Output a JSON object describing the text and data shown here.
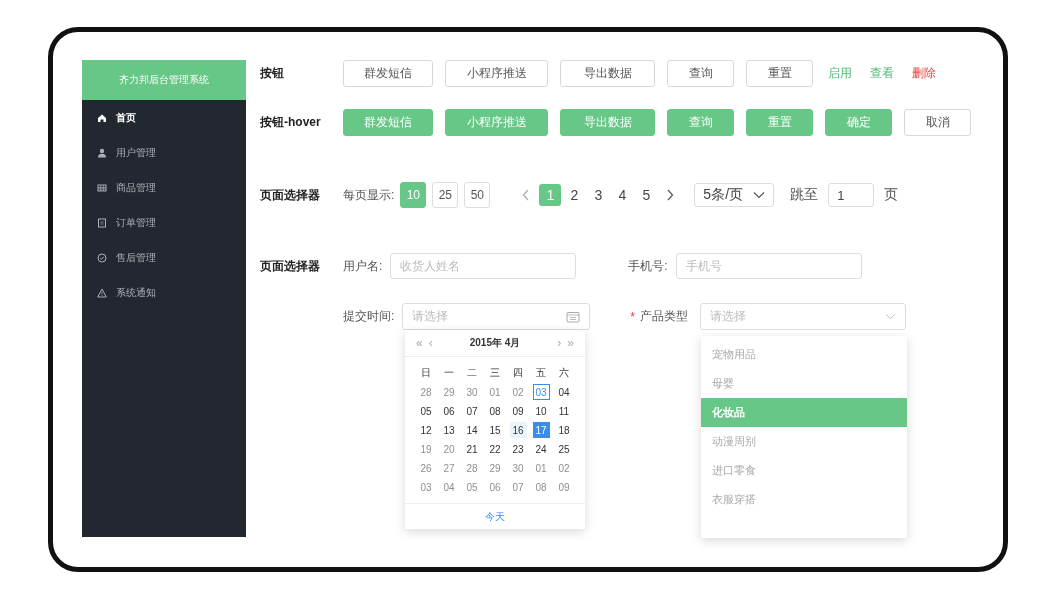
{
  "sidebar": {
    "title": "齐力邦后台管理系统",
    "items": [
      {
        "label": "首页",
        "selected": true
      },
      {
        "label": "用户管理",
        "selected": false
      },
      {
        "label": "商品管理",
        "selected": false
      },
      {
        "label": "订单管理",
        "selected": false
      },
      {
        "label": "售后管理",
        "selected": false
      },
      {
        "label": "系统通知",
        "selected": false
      }
    ]
  },
  "button_rows": [
    {
      "label": "按钮",
      "buttons": [
        {
          "label": "群发短信",
          "kind": "outline"
        },
        {
          "label": "小程序推送",
          "kind": "outline"
        },
        {
          "label": "导出数据",
          "kind": "outline"
        },
        {
          "label": "查询",
          "kind": "outline"
        },
        {
          "label": "重置",
          "kind": "outline"
        },
        {
          "label": "启用",
          "kind": "link-success"
        },
        {
          "label": "查看",
          "kind": "link-success"
        },
        {
          "label": "删除",
          "kind": "link-danger"
        }
      ]
    },
    {
      "label": "按钮-hover",
      "buttons": [
        {
          "label": "群发短信",
          "kind": "filled"
        },
        {
          "label": "小程序推送",
          "kind": "filled"
        },
        {
          "label": "导出数据",
          "kind": "filled"
        },
        {
          "label": "查询",
          "kind": "filled"
        },
        {
          "label": "重置",
          "kind": "filled"
        },
        {
          "label": "确定",
          "kind": "filled"
        },
        {
          "label": "取消",
          "kind": "outline"
        }
      ]
    }
  ],
  "pagination": {
    "label": "页面选择器",
    "page_size_label": "每页显示:",
    "page_sizes": [
      {
        "label": "10",
        "selected": true
      },
      {
        "label": "25",
        "selected": false
      },
      {
        "label": "50",
        "selected": false
      }
    ],
    "pages": [
      {
        "label": "1",
        "selected": true
      },
      {
        "label": "2",
        "selected": false
      },
      {
        "label": "3",
        "selected": false
      },
      {
        "label": "4",
        "selected": false
      },
      {
        "label": "5",
        "selected": false
      }
    ],
    "per_page": "5条/页",
    "jump_label": "跳至",
    "jump_value": "1",
    "page_unit": "页"
  },
  "form": {
    "label": "页面选择器",
    "username": {
      "label": "用户名:",
      "placeholder": "收货人姓名"
    },
    "phone": {
      "label": "手机号:",
      "placeholder": "手机号"
    },
    "submit_time": {
      "label": "提交时间:",
      "placeholder": "请选择"
    },
    "product_type": {
      "label": "产品类型",
      "required_mark": "*",
      "placeholder": "请选择",
      "options": [
        {
          "label": "宠物用品",
          "selected": false
        },
        {
          "label": "母婴",
          "selected": false
        },
        {
          "label": "化妆品",
          "selected": true
        },
        {
          "label": "动漫周别",
          "selected": false
        },
        {
          "label": "进口零食",
          "selected": false
        },
        {
          "label": "衣服穿搭",
          "selected": false
        }
      ]
    },
    "calendar": {
      "prev_year": "«",
      "prev_month": "‹",
      "title": "2015年 4月",
      "next_month": "›",
      "next_year": "»",
      "weekdays": [
        "日",
        "一",
        "二",
        "三",
        "四",
        "五",
        "六"
      ],
      "days": [
        {
          "label": "28",
          "kind": "muted"
        },
        {
          "label": "29",
          "kind": "muted"
        },
        {
          "label": "30",
          "kind": "muted"
        },
        {
          "label": "01",
          "kind": "muted"
        },
        {
          "label": "02",
          "kind": "muted"
        },
        {
          "label": "03",
          "kind": "today"
        },
        {
          "label": "04",
          "kind": "normal"
        },
        {
          "label": "05",
          "kind": "normal"
        },
        {
          "label": "06",
          "kind": "normal"
        },
        {
          "label": "07",
          "kind": "normal"
        },
        {
          "label": "08",
          "kind": "normal"
        },
        {
          "label": "09",
          "kind": "normal"
        },
        {
          "label": "10",
          "kind": "normal"
        },
        {
          "label": "11",
          "kind": "normal"
        },
        {
          "label": "12",
          "kind": "normal"
        },
        {
          "label": "13",
          "kind": "normal"
        },
        {
          "label": "14",
          "kind": "normal"
        },
        {
          "label": "15",
          "kind": "normal"
        },
        {
          "label": "16",
          "kind": "hover"
        },
        {
          "label": "17",
          "kind": "selected"
        },
        {
          "label": "18",
          "kind": "normal"
        },
        {
          "label": "19",
          "kind": "muted"
        },
        {
          "label": "20",
          "kind": "muted"
        },
        {
          "label": "21",
          "kind": "normal"
        },
        {
          "label": "22",
          "kind": "normal"
        },
        {
          "label": "23",
          "kind": "normal"
        },
        {
          "label": "24",
          "kind": "normal"
        },
        {
          "label": "25",
          "kind": "normal"
        },
        {
          "label": "26",
          "kind": "muted"
        },
        {
          "label": "27",
          "kind": "muted"
        },
        {
          "label": "28",
          "kind": "muted"
        },
        {
          "label": "29",
          "kind": "muted"
        },
        {
          "label": "30",
          "kind": "muted"
        },
        {
          "label": "01",
          "kind": "muted"
        },
        {
          "label": "02",
          "kind": "muted"
        },
        {
          "label": "03",
          "kind": "muted"
        },
        {
          "label": "04",
          "kind": "muted"
        },
        {
          "label": "05",
          "kind": "muted"
        },
        {
          "label": "06",
          "kind": "muted"
        },
        {
          "label": "07",
          "kind": "muted"
        },
        {
          "label": "08",
          "kind": "muted"
        },
        {
          "label": "09",
          "kind": "muted"
        }
      ],
      "today_button": "今天"
    }
  }
}
